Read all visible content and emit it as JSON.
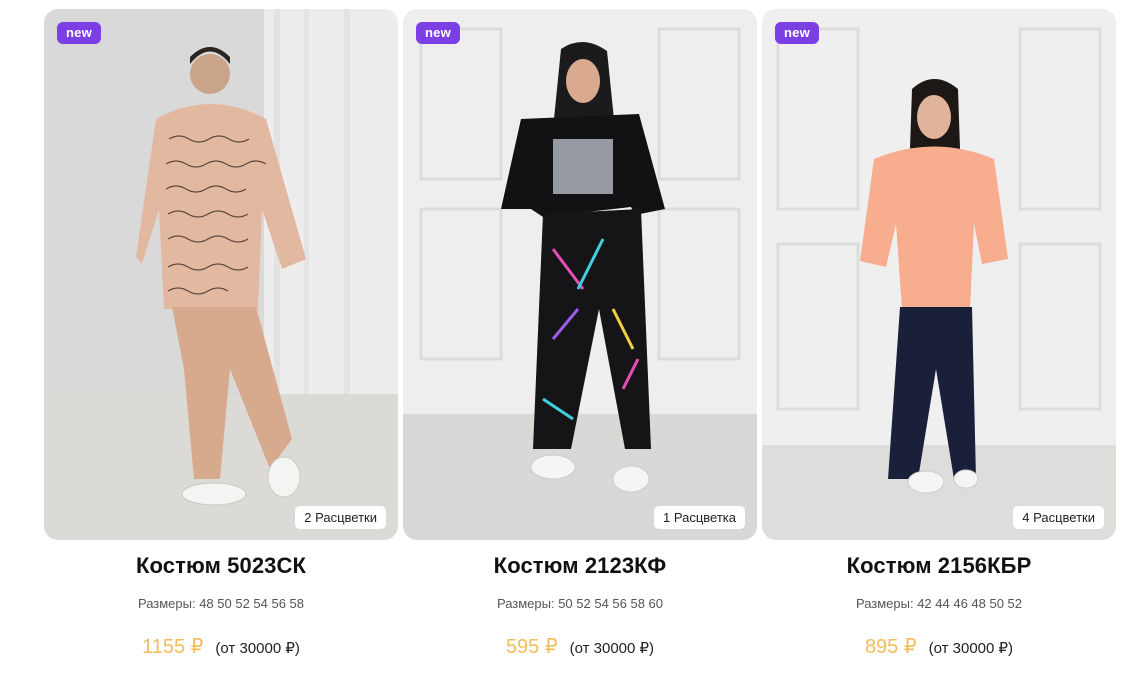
{
  "products": [
    {
      "badge": "new",
      "colors_label": "2 Расцветки",
      "title": "Костюм 5023СК",
      "sizes_label": "Размеры: 48 50 52 54 56 58",
      "price": "1155 ₽",
      "price_from": "(от 30000 ₽)"
    },
    {
      "badge": "new",
      "colors_label": "1 Расцветка",
      "title": "Костюм 2123КФ",
      "sizes_label": "Размеры: 50 52 54 56 58 60",
      "price": "595 ₽",
      "price_from": "(от 30000 ₽)"
    },
    {
      "badge": "new",
      "colors_label": "4 Расцветки",
      "title": "Костюм 2156КБР",
      "sizes_label": "Размеры: 42 44 46 48 50 52",
      "price": "895 ₽",
      "price_from": "(от 30000 ₽)"
    }
  ],
  "colors": {
    "badge_new": "#7b3fe4",
    "price": "#f2bd5a"
  }
}
